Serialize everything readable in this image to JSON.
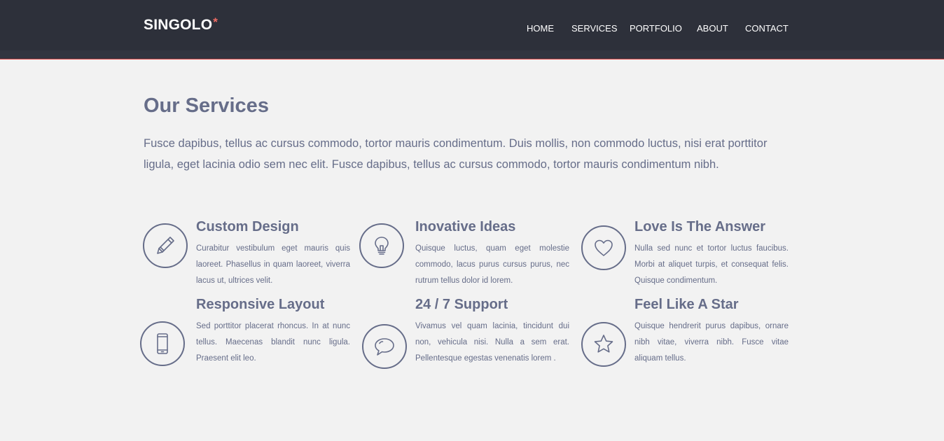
{
  "header": {
    "logo": "SINGOLO",
    "logo_mark": "*",
    "nav": [
      "HOME",
      "SERVICES",
      "PORTFOLIO",
      "ABOUT",
      "CONTACT"
    ]
  },
  "main": {
    "title": "Our Services",
    "lead": "Fusce dapibus, tellus ac cursus commodo, tortor mauris condimentum. Duis mollis, non commodo luctus, nisi erat porttitor ligula, eget lacinia odio sem nec elit. Fusce dapibus, tellus ac cursus commodo, tortor mauris condimentum nibh.",
    "services": [
      {
        "title": "Custom Design",
        "text": "Curabitur vestibulum eget mauris quis laoreet. Phasellus in quam laoreet, viverra lacus ut, ultrices velit.",
        "icon": "pencil-icon"
      },
      {
        "title": "Inovative Ideas",
        "text": "Quisque luctus, quam eget molestie commodo, lacus purus cursus purus, nec rutrum tellus dolor id lorem.",
        "icon": "lightbulb-icon"
      },
      {
        "title": "Love Is The Answer",
        "text": "Nulla sed nunc et tortor luctus faucibus. Morbi at aliquet turpis, et consequat felis. Quisque condimentum.",
        "icon": "heart-icon"
      },
      {
        "title": "Responsive Layout",
        "text": "Sed porttitor placerat rhoncus. In at nunc tellus. Maecenas blandit nunc ligula. Praesent elit leo.",
        "icon": "phone-icon"
      },
      {
        "title": "24 / 7 Support",
        "text": "Vivamus vel quam lacinia, tincidunt dui non, vehicula nisi. Nulla a sem erat. Pellentesque egestas venenatis lorem .",
        "icon": "chat-bubble-icon"
      },
      {
        "title": "Feel Like A Star",
        "text": "Quisque hendrerit purus dapibus, ornare nibh vitae, viverra nibh. Fusce vitae aliquam tellus.",
        "icon": "star-icon"
      }
    ]
  }
}
